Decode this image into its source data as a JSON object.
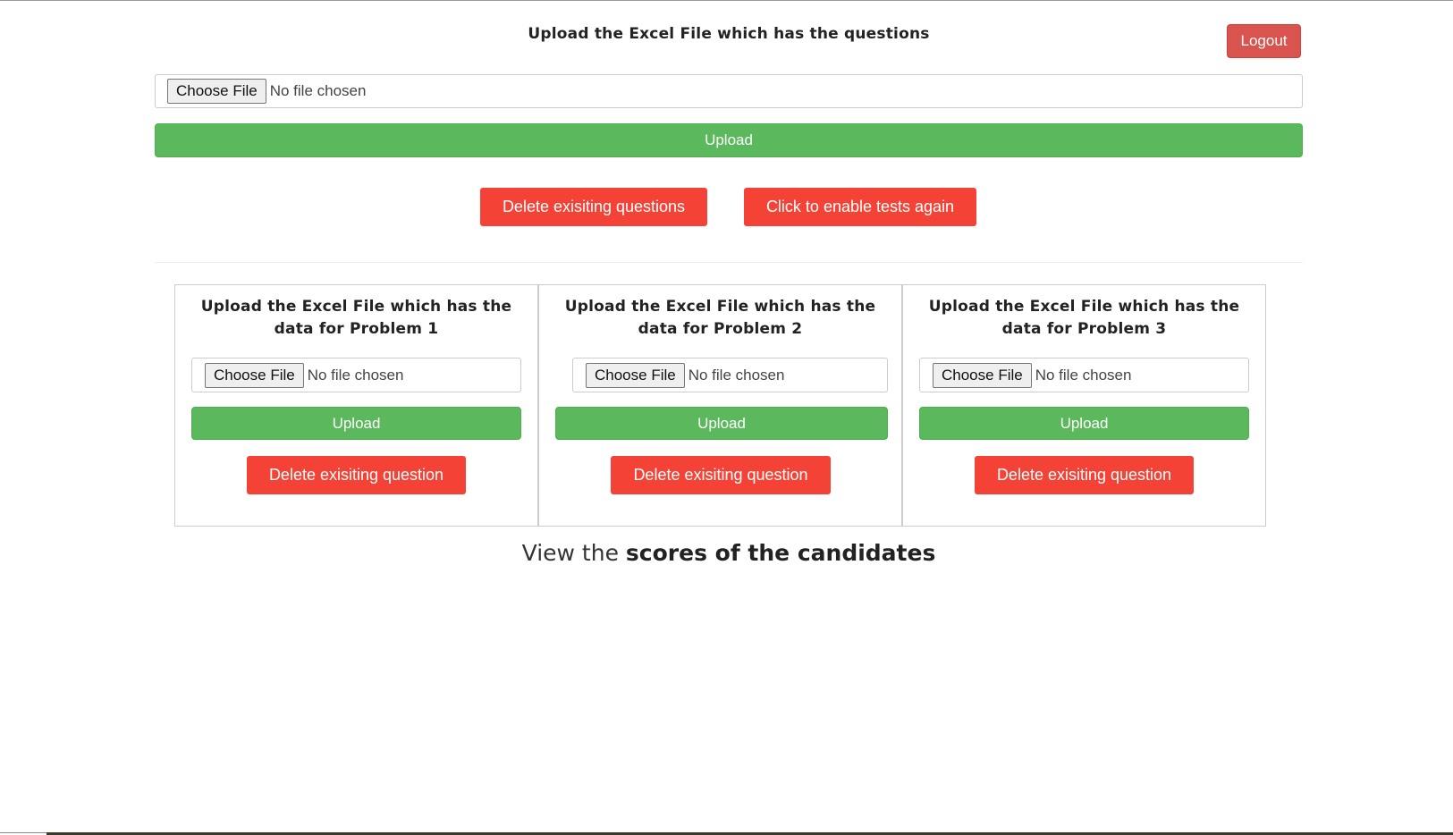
{
  "header": {
    "title": "Upload the Excel File which has the questions",
    "logout_label": "Logout"
  },
  "questions_upload": {
    "choose_file_label": "Choose File",
    "file_status": "No file chosen",
    "upload_label": "Upload"
  },
  "actions": {
    "delete_questions_label": "Delete exisiting questions",
    "enable_tests_label": "Click to enable tests again"
  },
  "problems": [
    {
      "heading_line1": "Upload the Excel File which has the",
      "heading_line2": "data for Problem 1",
      "choose_file_label": "Choose File",
      "file_status": "No file chosen",
      "upload_label": "Upload",
      "delete_label": "Delete exisiting question"
    },
    {
      "heading_line1": "Upload the Excel File which has the",
      "heading_line2": "data for Problem 2",
      "choose_file_label": "Choose File",
      "file_status": "No file chosen",
      "upload_label": "Upload",
      "delete_label": "Delete exisiting question"
    },
    {
      "heading_line1": "Upload the Excel File which has the",
      "heading_line2": "data for Problem 3",
      "choose_file_label": "Choose File",
      "file_status": "No file chosen",
      "upload_label": "Upload",
      "delete_label": "Delete exisiting question"
    }
  ],
  "scores": {
    "prefix": "View the",
    "link_text": "scores of the candidates"
  },
  "colors": {
    "upload_green": "#5cb85c",
    "delete_red": "#f44336",
    "logout_red": "#d9534f"
  }
}
